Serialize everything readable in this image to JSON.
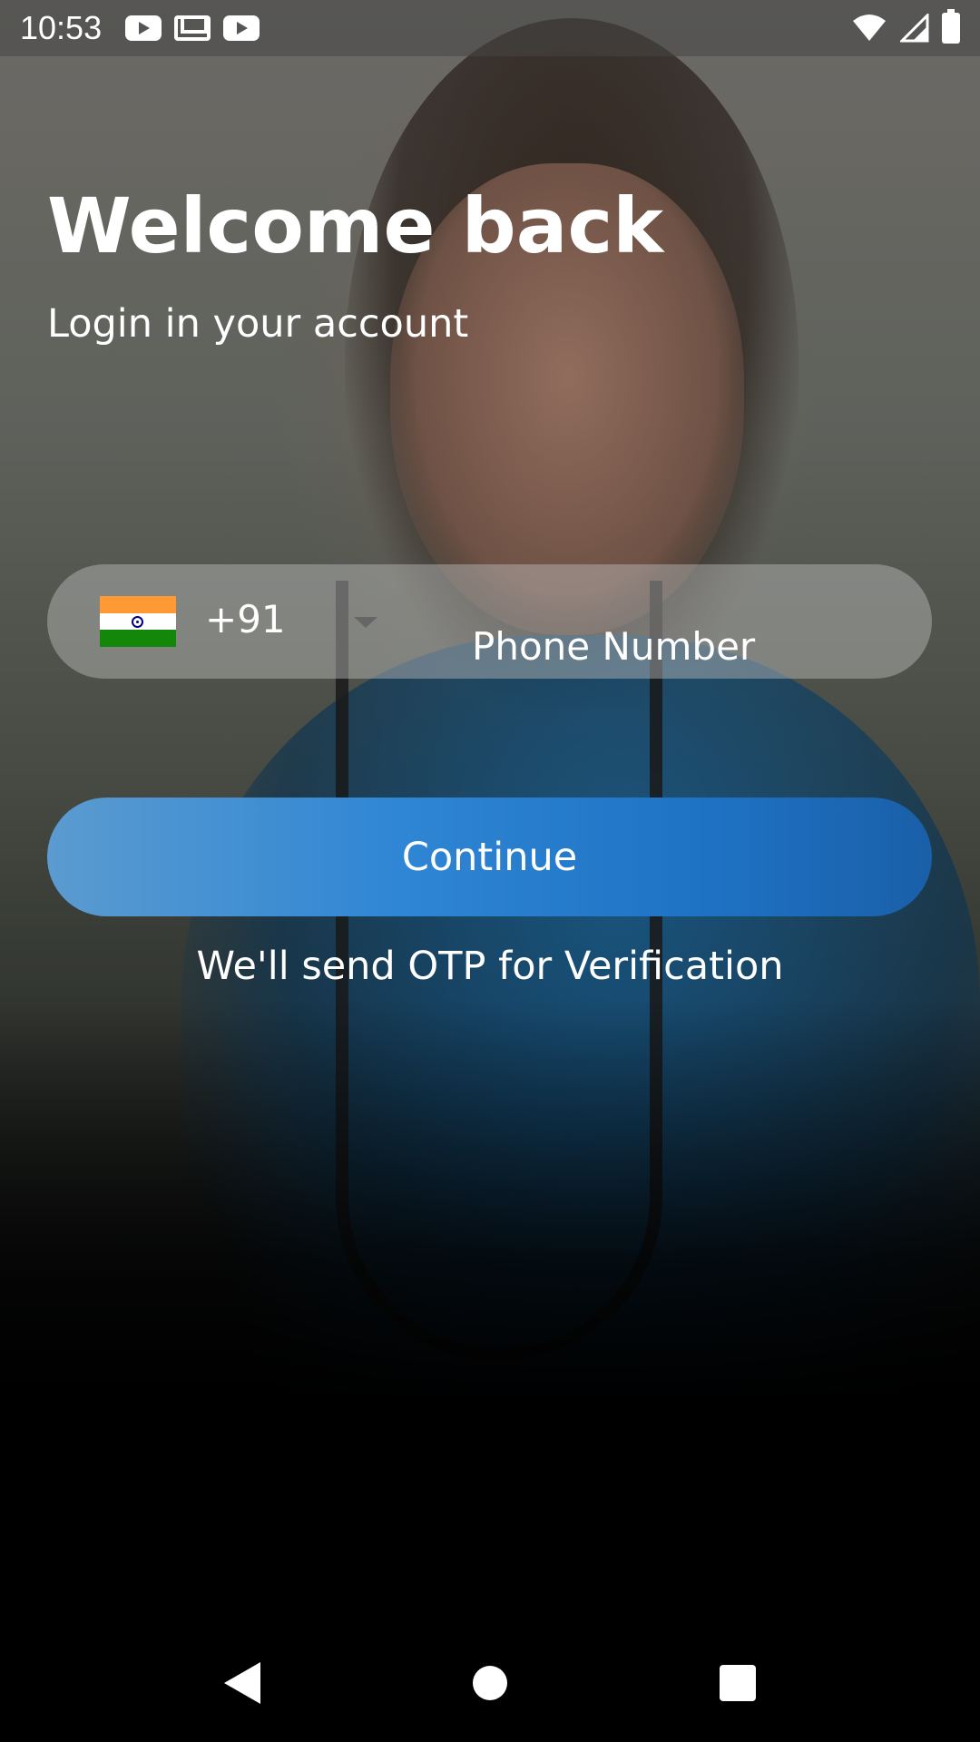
{
  "status_bar": {
    "time": "10:53",
    "notifications": [
      "youtube-icon",
      "gmail-icon",
      "youtube-icon"
    ],
    "system_icons": [
      "wifi-icon",
      "signal-icon",
      "battery-icon"
    ]
  },
  "header": {
    "title": "Welcome back",
    "subtitle": "Login in your account"
  },
  "phone_form": {
    "country_flag": "india-flag-icon",
    "country_code": "+91",
    "placeholder": "Phone Number"
  },
  "actions": {
    "continue_label": "Continue",
    "note": "We'll send OTP for Verification"
  },
  "colors": {
    "button_gradient_start": "#5b9bd0",
    "button_gradient_end": "#1a5fa8"
  }
}
